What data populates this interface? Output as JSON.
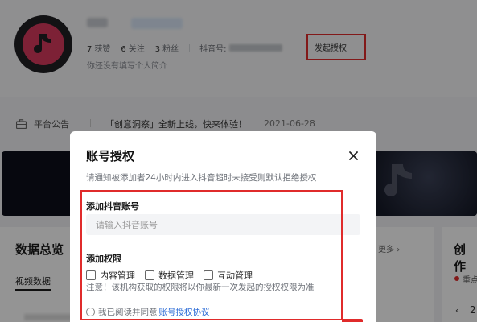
{
  "profile": {
    "stats": [
      {
        "num": "7",
        "label": "获赞"
      },
      {
        "num": "6",
        "label": "关注"
      },
      {
        "num": "3",
        "label": "粉丝"
      }
    ],
    "douyin_id_label": "抖音号:",
    "grant_label": "发起授权",
    "bio": "你还没有填写个人简介"
  },
  "notice": {
    "title": "平台公告",
    "text": "「创意洞察」全新上线，快来体验！",
    "date": "2021-06-28"
  },
  "data_overview": {
    "title": "数据总览",
    "tab": "视频数据",
    "more": "更多"
  },
  "creation": {
    "title": "创作",
    "sub": "重点",
    "nav_prev": "‹",
    "num": "2"
  },
  "modal": {
    "title": "账号授权",
    "close_icon": "close-icon",
    "description": "请通知被添加者24小时内进入抖音超时未接受则默认拒绝授权",
    "account_label": "添加抖音账号",
    "account_placeholder": "请输入抖音账号",
    "permission_label": "添加权限",
    "permissions": [
      "内容管理",
      "数据管理",
      "互动管理"
    ],
    "permission_note": "注意！该机构获取的权限将以你最新一次发起的授权权限为准",
    "agree_text": "我已阅读并同意",
    "agree_link": "账号授权协议"
  },
  "colors": {
    "accent_red": "#e02b2b",
    "link_blue": "#2b6bd6",
    "avatar_pink": "#d83a5e"
  }
}
